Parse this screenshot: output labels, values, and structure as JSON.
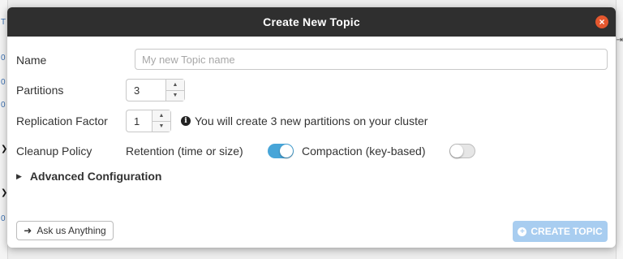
{
  "dialog": {
    "title": "Create New Topic",
    "close_icon": "close-icon"
  },
  "form": {
    "name": {
      "label": "Name",
      "placeholder": "My new Topic name",
      "value": ""
    },
    "partitions": {
      "label": "Partitions",
      "value": "3"
    },
    "replication": {
      "label": "Replication Factor",
      "value": "1",
      "info": "You will create 3 new partitions on your cluster"
    },
    "cleanup": {
      "label": "Cleanup Policy",
      "retention_label": "Retention (time or size)",
      "retention_on": true,
      "compaction_label": "Compaction (key-based)",
      "compaction_on": false
    },
    "advanced_label": "Advanced Configuration"
  },
  "footer": {
    "ask_label": "Ask us Anything",
    "create_label": "CREATE TOPIC"
  },
  "colors": {
    "accent": "#47a5d8",
    "close": "#e4572e",
    "create_disabled": "#a8cdf0",
    "titlebar": "#2f2f2f"
  }
}
